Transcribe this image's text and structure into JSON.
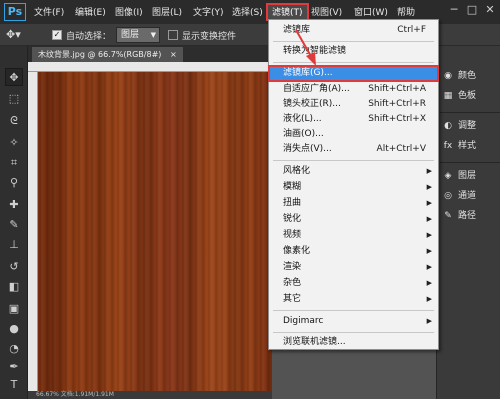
{
  "app": {
    "logo": "Ps"
  },
  "menubar": {
    "items": [
      "文件(F)",
      "编辑(E)",
      "图像(I)",
      "图层(L)",
      "文字(Y)",
      "选择(S)",
      "滤镜(T)",
      "视图(V)",
      "窗口(W)",
      "帮助"
    ],
    "active_index": 6
  },
  "window_controls": {
    "minimize": "─",
    "restore": "□",
    "close": "✕"
  },
  "options_bar": {
    "auto_select_label": "自动选择：",
    "auto_select_checked": true,
    "layer_select_value": "图层",
    "show_transform_label": "显示变换控件",
    "show_transform_checked": false
  },
  "document_tab": {
    "title": "木纹背景.jpg @ 66.7%(RGB/8#)",
    "close": "×"
  },
  "status_bar": {
    "text": "66.67%     文档:1.91M/1.91M"
  },
  "filter_menu": {
    "items": [
      {
        "label": "滤镜库",
        "shortcut": "Ctrl+F"
      },
      {
        "separator": true
      },
      {
        "label": "转换为智能滤镜"
      },
      {
        "separator": true
      },
      {
        "label": "滤镜库(G)...",
        "highlighted": true
      },
      {
        "label": "自适应广角(A)...",
        "shortcut": "Shift+Ctrl+A"
      },
      {
        "label": "镜头校正(R)...",
        "shortcut": "Shift+Ctrl+R"
      },
      {
        "label": "液化(L)...",
        "shortcut": "Shift+Ctrl+X"
      },
      {
        "label": "油画(O)..."
      },
      {
        "label": "消失点(V)...",
        "shortcut": "Alt+Ctrl+V"
      },
      {
        "separator": true
      },
      {
        "label": "风格化",
        "submenu": true
      },
      {
        "label": "模糊",
        "submenu": true
      },
      {
        "label": "扭曲",
        "submenu": true
      },
      {
        "label": "锐化",
        "submenu": true
      },
      {
        "label": "视频",
        "submenu": true
      },
      {
        "label": "像素化",
        "submenu": true
      },
      {
        "label": "渲染",
        "submenu": true
      },
      {
        "label": "杂色",
        "submenu": true
      },
      {
        "label": "其它",
        "submenu": true
      },
      {
        "separator": true
      },
      {
        "label": "Digimarc",
        "submenu": true
      },
      {
        "separator": true
      },
      {
        "label": "浏览联机滤镜..."
      }
    ]
  },
  "right_panel": {
    "items": [
      {
        "icon": "palette-icon",
        "glyph": "◉",
        "label": "颜色"
      },
      {
        "icon": "swatches-icon",
        "glyph": "▦",
        "label": "色板"
      },
      {
        "icon": "adjustments-icon",
        "glyph": "◐",
        "label": "调整"
      },
      {
        "icon": "styles-icon",
        "glyph": "fx",
        "label": "样式"
      },
      {
        "icon": "layers-icon",
        "glyph": "◈",
        "label": "图层"
      },
      {
        "icon": "channels-icon",
        "glyph": "◎",
        "label": "通道"
      },
      {
        "icon": "paths-icon",
        "glyph": "✎",
        "label": "路径"
      }
    ]
  },
  "colors": {
    "menubar_bg": "#2b2b2b",
    "workspace_bg": "#535353",
    "menu_bg": "#f2f2f2",
    "menu_highlight": "#3b8ee6",
    "annotation_red": "#e03a3a",
    "wood_base": "#8a3a16"
  }
}
